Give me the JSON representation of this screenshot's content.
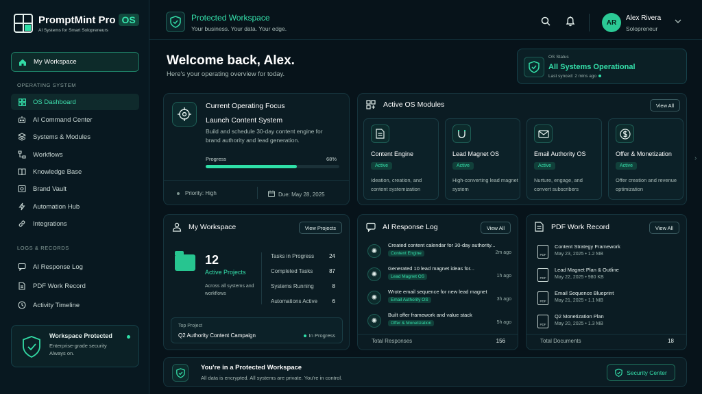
{
  "brand": {
    "name": "PromptMint Pro",
    "badge": "OS",
    "tagline": "AI Systems for Smart Solopreneurs"
  },
  "sidebar": {
    "workspace_label": "My Workspace",
    "section_os": "OPERATING SYSTEM",
    "os_items": [
      {
        "label": "OS Dashboard",
        "icon": "grid-icon",
        "selected": true
      },
      {
        "label": "AI Command Center",
        "icon": "robot-icon"
      },
      {
        "label": "Systems & Modules",
        "icon": "layers-icon"
      },
      {
        "label": "Workflows",
        "icon": "workflow-icon"
      },
      {
        "label": "Knowledge Base",
        "icon": "book-icon"
      },
      {
        "label": "Brand Vault",
        "icon": "vault-icon"
      },
      {
        "label": "Automation Hub",
        "icon": "bolt-icon"
      },
      {
        "label": "Integrations",
        "icon": "link-icon"
      }
    ],
    "section_logs": "LOGS & RECORDS",
    "log_items": [
      {
        "label": "AI Response Log",
        "icon": "chat-icon"
      },
      {
        "label": "PDF Work Record",
        "icon": "document-icon"
      },
      {
        "label": "Activity Timeline",
        "icon": "clock-icon"
      }
    ],
    "protect": {
      "title": "Workspace Protected",
      "line1": "Enterprise-grade security",
      "line2": "Always on."
    }
  },
  "header": {
    "title": "Protected Workspace",
    "subtitle": "Your business. Your data. Your edge.",
    "user": {
      "initials": "AR",
      "name": "Alex Rivera",
      "role": "Solopreneur"
    }
  },
  "welcome": {
    "title": "Welcome back, Alex.",
    "subtitle": "Here's your operating overview for today."
  },
  "os_status": {
    "label": "OS Status",
    "value": "All Systems Operational",
    "synced": "Last synced: 2 mins ago"
  },
  "focus": {
    "heading": "Current Operating Focus",
    "name": "Launch Content System",
    "description": "Build and schedule 30-day content engine for brand authority and lead generation.",
    "progress_label": "Progress",
    "progress_text": "68%",
    "progress_fraction": 0.68,
    "priority": "Priority: High",
    "due": "Due: May 28, 2025"
  },
  "modules": {
    "title": "Active OS Modules",
    "view_all": "View All",
    "items": [
      {
        "name": "Content Engine",
        "status": "Active",
        "description": "Ideation, creation, and content systemization",
        "icon": "document-icon"
      },
      {
        "name": "Lead Magnet OS",
        "status": "Active",
        "description": "High-converting lead magnet system",
        "icon": "magnet-icon"
      },
      {
        "name": "Email Authority OS",
        "status": "Active",
        "description": "Nurture, engage, and convert subscribers",
        "icon": "mail-icon"
      },
      {
        "name": "Offer & Monetization",
        "status": "Active",
        "description": "Offer creation and revenue optimization",
        "icon": "dollar-icon"
      }
    ]
  },
  "workspace": {
    "title": "My Workspace",
    "view_projects": "View Projects",
    "count": "12",
    "count_label": "Active Projects",
    "count_sub": "Across all systems and workflows",
    "stats": [
      {
        "label": "Tasks in Progress",
        "value": "24"
      },
      {
        "label": "Completed Tasks",
        "value": "87"
      },
      {
        "label": "Systems Running",
        "value": "8"
      },
      {
        "label": "Automations Active",
        "value": "6"
      }
    ],
    "top_project": {
      "label": "Top Project",
      "name": "Q2 Authority Content Campaign",
      "status": "In Progress"
    }
  },
  "ai_log": {
    "title": "AI Response Log",
    "view_all": "View All",
    "entries": [
      {
        "text": "Created content calendar for 30-day authority...",
        "tag": "Content Engine",
        "time": "2m ago"
      },
      {
        "text": "Generated 10 lead magnet ideas for...",
        "tag": "Lead Magnet OS",
        "time": "1h ago"
      },
      {
        "text": "Wrote email sequence for new lead magnet",
        "tag": "Email Authority OS",
        "time": "3h ago"
      },
      {
        "text": "Built offer framework and value stack",
        "tag": "Offer & Monetization",
        "time": "5h ago"
      }
    ],
    "total_label": "Total Responses",
    "total_value": "156"
  },
  "pdf": {
    "title": "PDF Work Record",
    "view_all": "View All",
    "entries": [
      {
        "name": "Content Strategy Framework",
        "meta": "May 23, 2025  •  1.2 MB"
      },
      {
        "name": "Lead Magnet Plan & Outline",
        "meta": "May 22, 2025  •  980 KB"
      },
      {
        "name": "Email Sequence Blueprint",
        "meta": "May 21, 2025  •  1.1 MB"
      },
      {
        "name": "Q2 Monetization Plan",
        "meta": "May 20, 2025  •  1.3 MB"
      }
    ],
    "total_label": "Total Documents",
    "total_value": "18",
    "file_badge": "PDF"
  },
  "banner": {
    "title": "You're in a Protected Workspace",
    "subtitle": "All data is encrypted. All systems are private. You're in control.",
    "button": "Security Center"
  },
  "colors": {
    "accent": "#2fe0a8",
    "background": "#07131a",
    "card": "#0b1c23"
  }
}
